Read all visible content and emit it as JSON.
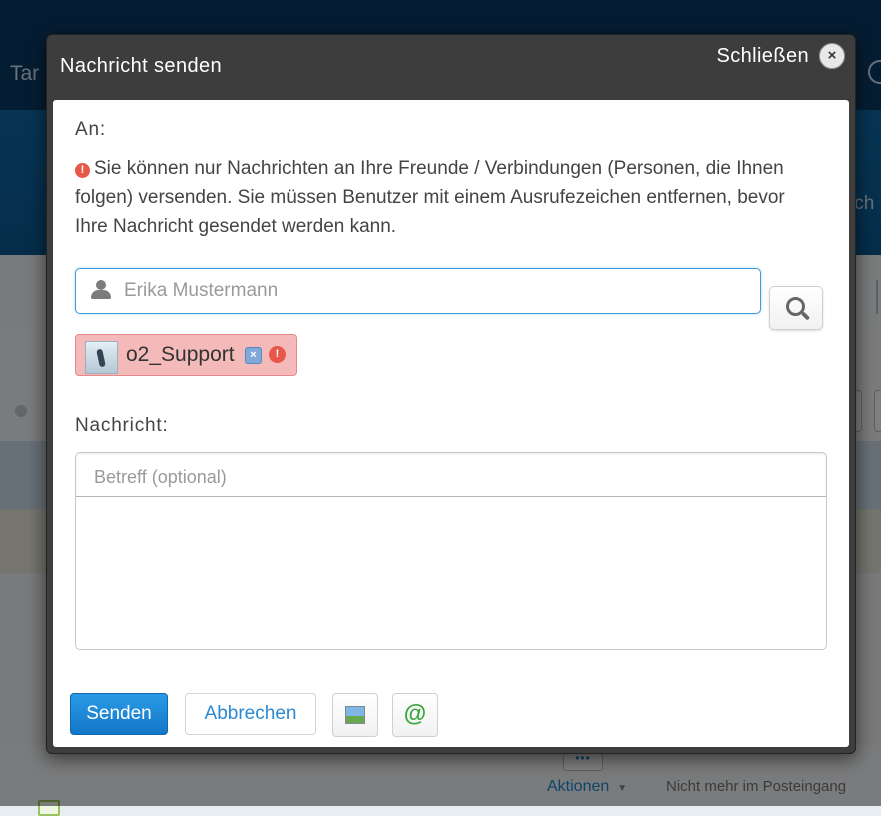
{
  "background": {
    "hero_left_text": "Tar",
    "hero_right_text": "ich",
    "more_label": "•••",
    "actions_label": "Aktionen",
    "not_in_inbox_label": "Nicht mehr im Posteingang"
  },
  "dialog": {
    "title": "Nachricht senden",
    "close_label": "Schließen",
    "close_icon": "×",
    "to_label": "An:",
    "warning_icon": "!",
    "warning_text": "Sie können nur Nachrichten an Ihre Freunde / Verbindungen (Personen, die Ihnen folgen) versenden. Sie müssen Benutzer mit einem Ausrufezeichen entfernen, bevor Ihre Nachricht gesendet werden kann.",
    "to_input": {
      "value": "",
      "placeholder": "Erika Mustermann"
    },
    "recipient": {
      "name": "o2_Support",
      "remove_icon": "×",
      "warning_icon": "!"
    },
    "message_label": "Nachricht:",
    "subject": {
      "value": "",
      "placeholder": "Betreff (optional)"
    },
    "body": {
      "value": ""
    },
    "buttons": {
      "send": "Senden",
      "cancel": "Abbrechen",
      "mention_glyph": "@"
    }
  },
  "colors": {
    "primary": "#1a8bd0",
    "dialog_frame": "#3d3d3d",
    "warning": "#e8584a",
    "recipient_error_bg": "#f4b9b9"
  }
}
